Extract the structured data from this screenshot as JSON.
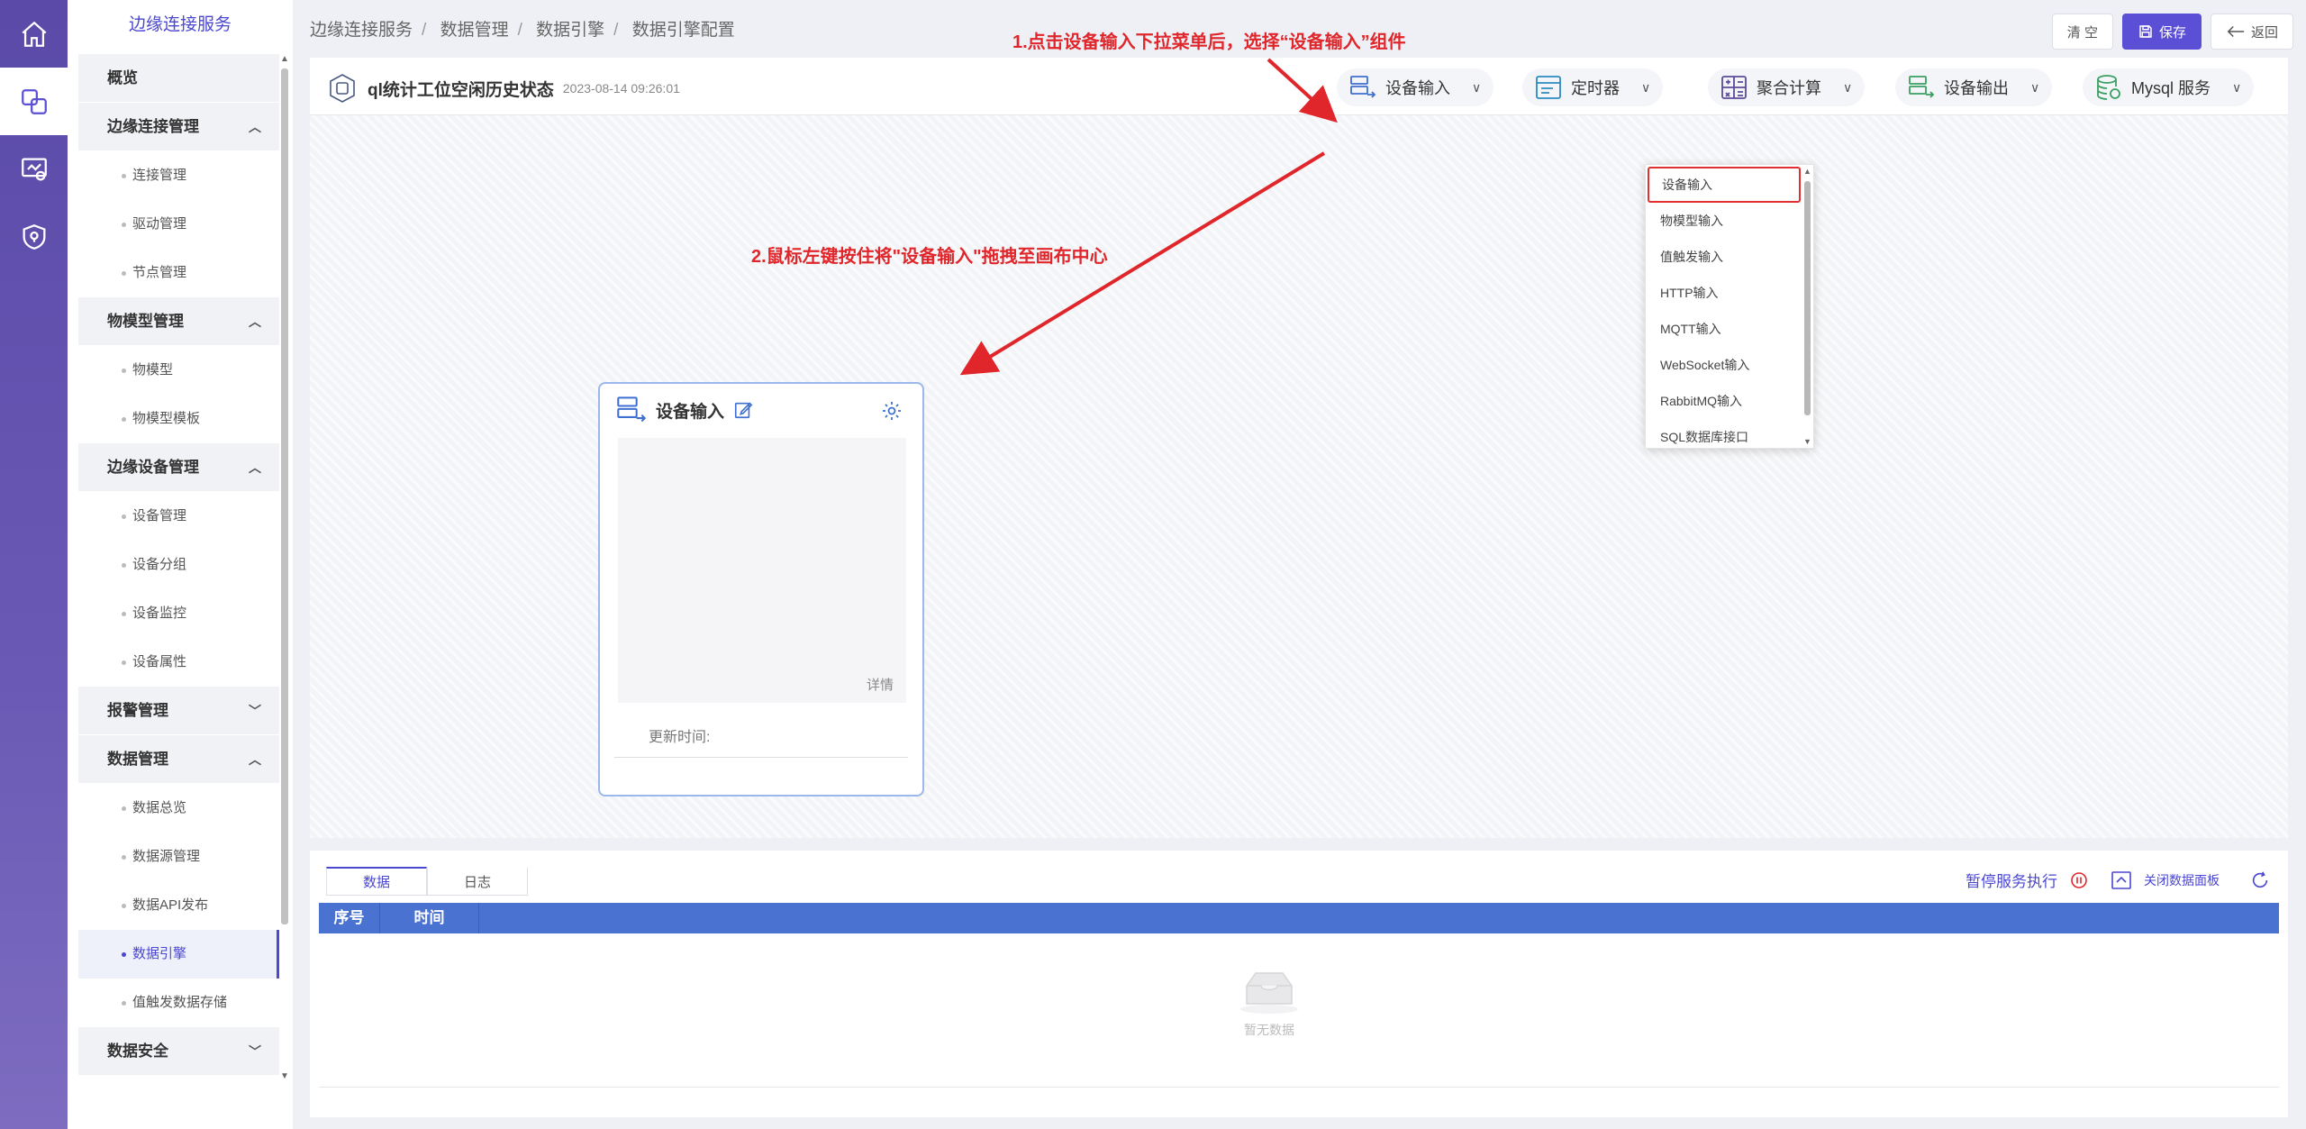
{
  "rail": [
    "home-icon",
    "edge-connect-icon",
    "monitor-icon",
    "shield-icon"
  ],
  "sidebar": {
    "title": "边缘连接服务",
    "items": [
      {
        "type": "group",
        "label": "概览",
        "caret": ""
      },
      {
        "type": "group",
        "label": "边缘连接管理",
        "caret": "^"
      },
      {
        "type": "sub",
        "label": "连接管理"
      },
      {
        "type": "sub",
        "label": "驱动管理"
      },
      {
        "type": "sub",
        "label": "节点管理"
      },
      {
        "type": "group",
        "label": "物模型管理",
        "caret": "^"
      },
      {
        "type": "sub",
        "label": "物模型"
      },
      {
        "type": "sub",
        "label": "物模型模板"
      },
      {
        "type": "group",
        "label": "边缘设备管理",
        "caret": "^"
      },
      {
        "type": "sub",
        "label": "设备管理"
      },
      {
        "type": "sub",
        "label": "设备分组"
      },
      {
        "type": "sub",
        "label": "设备监控"
      },
      {
        "type": "sub",
        "label": "设备属性"
      },
      {
        "type": "group",
        "label": "报警管理",
        "caret": "v"
      },
      {
        "type": "group",
        "label": "数据管理",
        "caret": "^"
      },
      {
        "type": "sub",
        "label": "数据总览"
      },
      {
        "type": "sub",
        "label": "数据源管理"
      },
      {
        "type": "sub",
        "label": "数据API发布"
      },
      {
        "type": "sub",
        "label": "数据引擎",
        "active": true
      },
      {
        "type": "sub",
        "label": "值触发数据存储"
      },
      {
        "type": "group",
        "label": "数据安全",
        "caret": "v"
      }
    ]
  },
  "breadcrumb": [
    "边缘连接服务",
    "数据管理",
    "数据引擎",
    "数据引擎配置"
  ],
  "header": {
    "clear_label": "清 空",
    "save_label": "保存",
    "back_label": "返回"
  },
  "flow": {
    "name": "ql统计工位空闲历史状态",
    "time": "2023-08-14 09:26:01"
  },
  "tools": [
    {
      "label": "设备输入",
      "icon": "device-input-icon"
    },
    {
      "label": "定时器",
      "icon": "timer-icon"
    },
    {
      "label": "聚合计算",
      "icon": "calculator-icon"
    },
    {
      "label": "设备输出",
      "icon": "device-output-icon"
    },
    {
      "label": "Mysql 服务",
      "icon": "database-icon"
    }
  ],
  "dropdown": [
    "设备输入",
    "物模型输入",
    "值触发输入",
    "HTTP输入",
    "MQTT输入",
    "WebSocket输入",
    "RabbitMQ输入",
    "SQL数据库接口"
  ],
  "annotations": {
    "step1": "1.点击设备输入下拉菜单后，选择“设备输入”组件",
    "step2": "2.鼠标左键按住将\"设备输入\"拖拽至画布中心"
  },
  "node": {
    "title": "设备输入",
    "detail": "详情",
    "update_label": "更新时间:"
  },
  "data_panel": {
    "tabs": [
      "数据",
      "日志"
    ],
    "pause_label": "暂停服务执行",
    "close_label": "关闭数据面板",
    "columns": [
      "序号",
      "时间"
    ],
    "empty_text": "暂无数据"
  },
  "colors": {
    "accent": "#4b47d0",
    "annotation": "#e0262b",
    "table_header": "#4a72d0"
  }
}
